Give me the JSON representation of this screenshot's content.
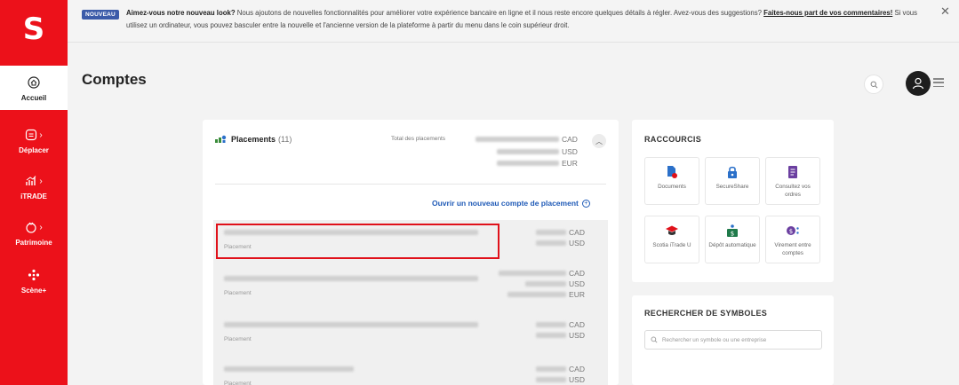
{
  "banner": {
    "badge": "NOUVEAU",
    "headline": "Aimez-vous notre nouveau look?",
    "body": " Nous ajoutons de nouvelles fonctionnalités pour améliorer votre expérience bancaire en ligne et il nous reste encore quelques détails à régler. Avez-vous des suggestions? ",
    "cta": "Faites-nous part de vos commentaires!",
    "tail": " Si vous utilisez un ordinateur, vous pouvez basculer entre la nouvelle et l'ancienne version de la plateforme à partir du menu dans le coin supérieur droit.",
    "close": "✕"
  },
  "sidebar": {
    "logo": "S",
    "items": [
      {
        "label": "Accueil"
      },
      {
        "label": "Déplacer"
      },
      {
        "label": "iTRADE"
      },
      {
        "label": "Patrimoine"
      },
      {
        "label": "Scène+"
      }
    ]
  },
  "header": {
    "title": "Comptes"
  },
  "placements": {
    "title": "Placements",
    "count": "(11)",
    "total_label": "Total des placements",
    "totals": [
      "CAD",
      "USD",
      "EUR"
    ],
    "open_link": "Ouvrir un nouveau compte de placement",
    "accounts": [
      {
        "type": "Placement",
        "currencies": [
          "CAD",
          "USD"
        ]
      },
      {
        "type": "Placement",
        "currencies": [
          "CAD",
          "USD",
          "EUR"
        ]
      },
      {
        "type": "Placement",
        "currencies": [
          "CAD",
          "USD"
        ]
      },
      {
        "type": "Placement",
        "currencies": [
          "CAD",
          "USD"
        ]
      }
    ]
  },
  "shortcuts": {
    "title": "RACCOURCIS",
    "items": [
      {
        "label": "Documents"
      },
      {
        "label": "SecureShare"
      },
      {
        "label": "Consultez vos ordres"
      },
      {
        "label": "Scotia iTrade U"
      },
      {
        "label": "Dépôt automatique"
      },
      {
        "label": "Virement entre comptes"
      }
    ]
  },
  "symbols": {
    "title": "RECHERCHER DE SYMBOLES",
    "placeholder": "Rechercher un symbole ou une entreprise"
  },
  "colors": {
    "brand": "#ec111a",
    "link": "#1f5ab7",
    "highlight": "#e0111a"
  }
}
